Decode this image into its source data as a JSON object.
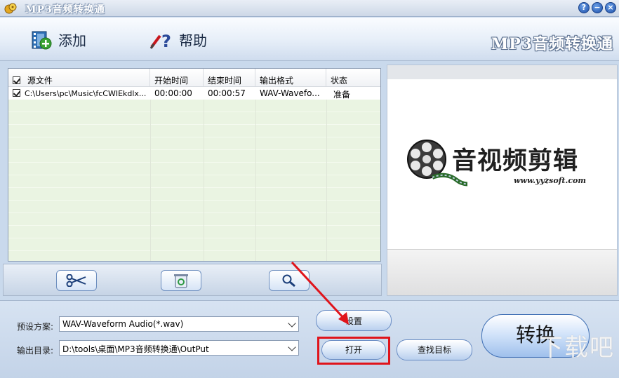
{
  "window": {
    "title": "MP3音频转换通",
    "buttons": [
      "?",
      "−",
      "×"
    ]
  },
  "toolbar": {
    "add_label": "添加",
    "help_label": "帮助",
    "brand": "MP3音频转换通"
  },
  "file_list": {
    "columns": [
      "源文件",
      "开始时间",
      "结束时间",
      "输出格式",
      "状态"
    ],
    "rows": [
      {
        "checked": true,
        "source": "C:\\Users\\pc\\Music\\fcCWIEkdlx...",
        "start": "00:00:00",
        "end": "00:00:57",
        "format": "WAV-Wavefo...",
        "status": "准备"
      }
    ]
  },
  "preview": {
    "logo_text": "音视频剪辑",
    "logo_url": "www.yyzsoft.com"
  },
  "tool_strip": {
    "icons": [
      "scissors-icon",
      "recycle-icon",
      "magnifier-icon"
    ]
  },
  "settings": {
    "preset_label": "预设方案:",
    "preset_value": "WAV-Waveform Audio(*.wav)",
    "output_label": "输出目录:",
    "output_value": "D:\\tools\\桌面\\MP3音频转换通\\OutPut",
    "settings_button": "设置",
    "open_button": "打开",
    "find_target_button": "查找目标",
    "convert_button": "转换"
  },
  "watermark": "下载吧",
  "colors": {
    "highlight_red": "#e0141b",
    "row_green": "#eaf4e2"
  }
}
